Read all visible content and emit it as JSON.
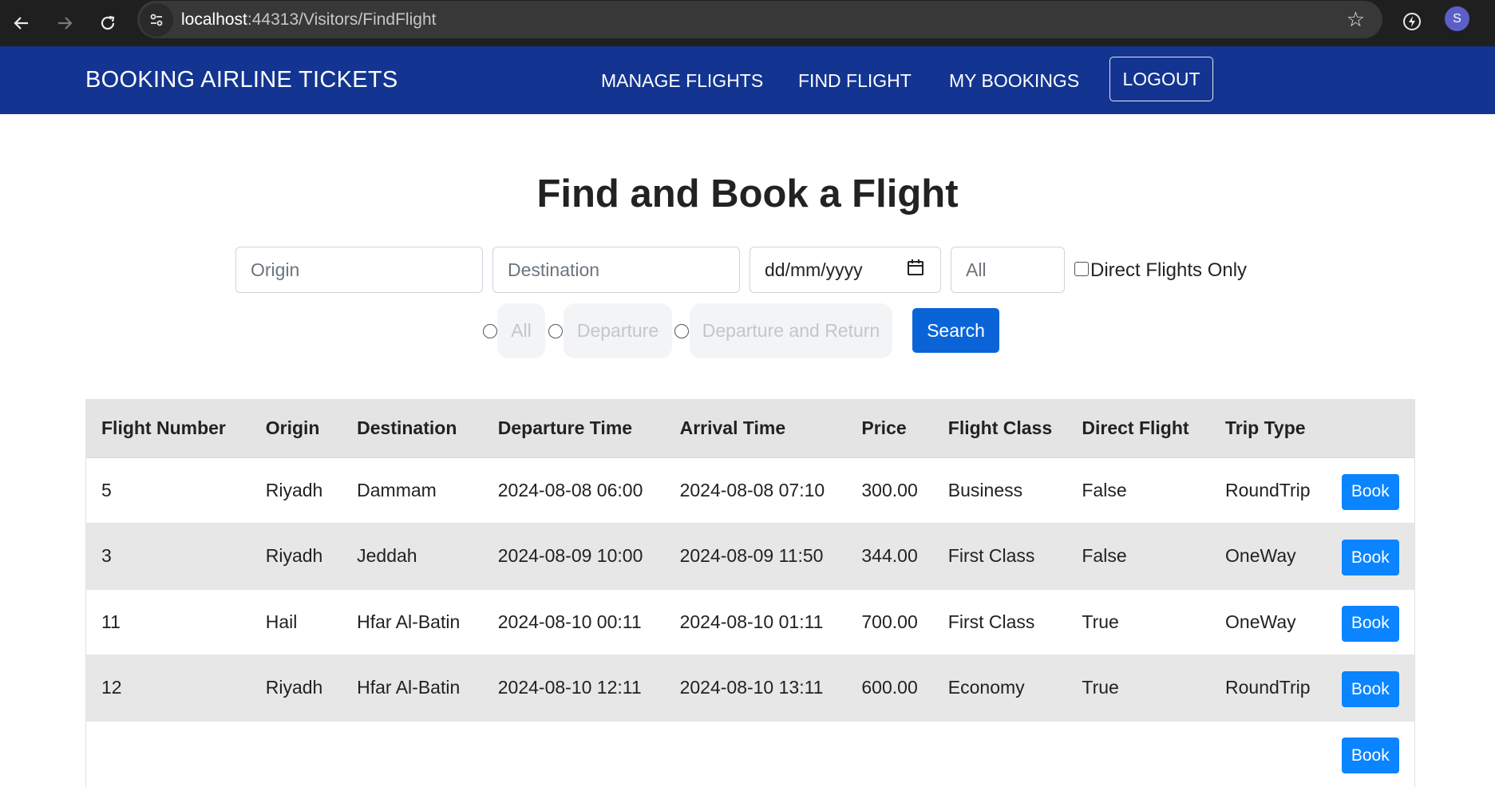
{
  "browser": {
    "url_host": "localhost",
    "url_path": ":44313/Visitors/FindFlight",
    "profile_initial": "S",
    "back_icon": "arrow-left-icon",
    "forward_icon": "arrow-right-icon",
    "reload_icon": "reload-icon",
    "bookmark_icon": "star-icon"
  },
  "navbar": {
    "brand": "BOOKING AIRLINE TICKETS",
    "links": [
      "MANAGE FLIGHTS",
      "FIND FLIGHT",
      "MY BOOKINGS"
    ],
    "logout": "LOGOUT",
    "bg_color": "#133591"
  },
  "page": {
    "title": "Find and Book a Flight"
  },
  "search": {
    "origin_placeholder": "Origin",
    "destination_placeholder": "Destination",
    "date_placeholder": "dd/mm/yyyy",
    "class_value": "All",
    "direct_label": "Direct Flights Only",
    "trip_options": [
      "All",
      "Departure",
      "Departure and Return"
    ],
    "search_label": "Search",
    "accent_color": "#0a64d8"
  },
  "table": {
    "headers": [
      "Flight Number",
      "Origin",
      "Destination",
      "Departure Time",
      "Arrival Time",
      "Price",
      "Flight Class",
      "Direct Flight",
      "Trip Type",
      ""
    ],
    "rows": [
      {
        "number": "5",
        "origin": "Riyadh",
        "destination": "Dammam",
        "departure": "2024-08-08 06:00",
        "arrival": "2024-08-08 07:10",
        "price": "300.00",
        "class": "Business",
        "direct": "False",
        "trip": "RoundTrip",
        "action": "Book"
      },
      {
        "number": "3",
        "origin": "Riyadh",
        "destination": "Jeddah",
        "departure": "2024-08-09 10:00",
        "arrival": "2024-08-09 11:50",
        "price": "344.00",
        "class": "First Class",
        "direct": "False",
        "trip": "OneWay",
        "action": "Book"
      },
      {
        "number": "11",
        "origin": "Hail",
        "destination": "Hfar Al-Batin",
        "departure": "2024-08-10 00:11",
        "arrival": "2024-08-10 01:11",
        "price": "700.00",
        "class": "First Class",
        "direct": "True",
        "trip": "OneWay",
        "action": "Book"
      },
      {
        "number": "12",
        "origin": "Riyadh",
        "destination": "Hfar Al-Batin",
        "departure": "2024-08-10 12:11",
        "arrival": "2024-08-10 13:11",
        "price": "600.00",
        "class": "Economy",
        "direct": "True",
        "trip": "RoundTrip",
        "action": "Book"
      },
      {
        "number": "",
        "origin": "",
        "destination": "",
        "departure": "",
        "arrival": "",
        "price": "",
        "class": "",
        "direct": "",
        "trip": "",
        "action": "Book"
      }
    ]
  }
}
